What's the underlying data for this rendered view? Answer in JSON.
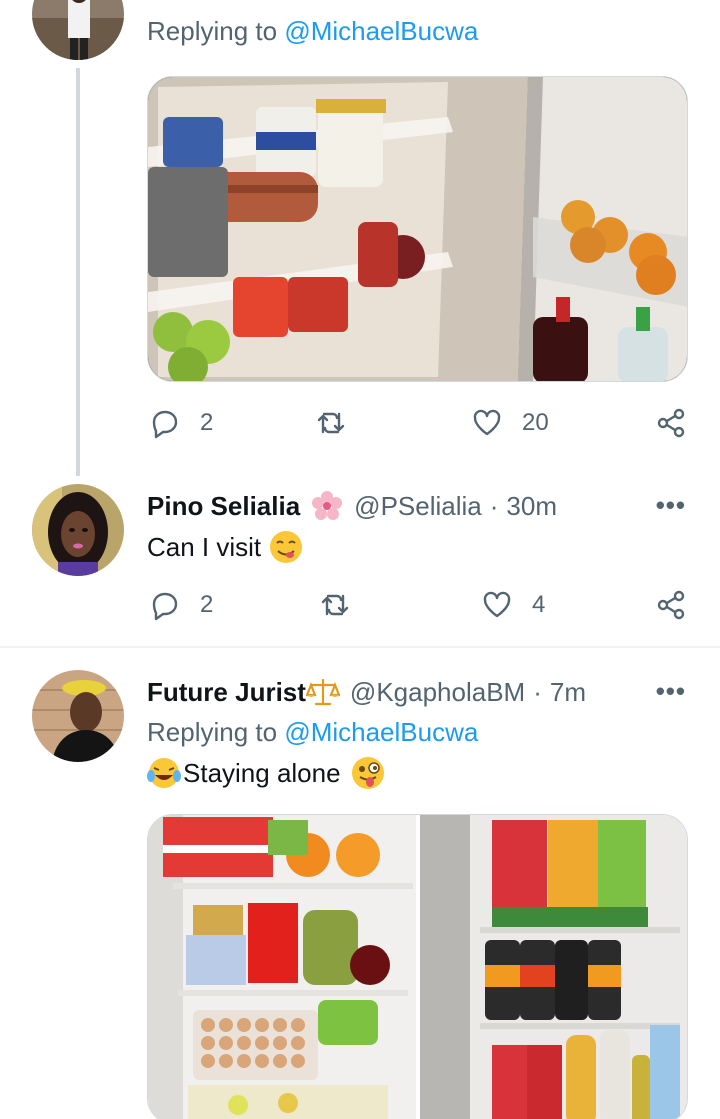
{
  "tweet1": {
    "replying_prefix": "Replying to",
    "replying_handle": "@MichaelBucwa",
    "replies": "2",
    "likes": "20"
  },
  "tweet2": {
    "display_name": "Pino Selialia",
    "name_emoji": "flower-emoji",
    "handle": "@PSelialia",
    "time": "30m",
    "text": "Can I visit",
    "text_emoji": "yum-face-emoji",
    "replies": "2",
    "likes": "4"
  },
  "tweet3": {
    "display_name": "Future Jurist",
    "name_emoji": "scales-emoji",
    "handle": "@KgapholaBM",
    "time": "7m",
    "replying_prefix": "Replying to",
    "replying_handle": "@MichaelBucwa",
    "text": "Staying alone",
    "leading_emoji": "crying-laughing-emoji",
    "trailing_emoji": "winking-tongue-emoji"
  },
  "colors": {
    "accent": "#1d9bf0",
    "secondary_text": "#536471",
    "primary_text": "#0f1419"
  },
  "more_label": "•••",
  "separator": "·"
}
